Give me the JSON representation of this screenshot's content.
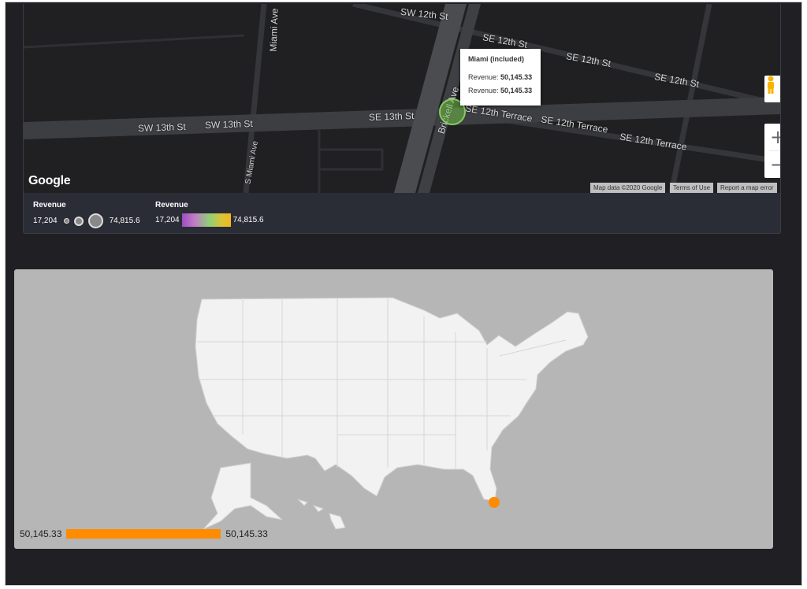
{
  "map": {
    "streets": {
      "sw12th": "SW 12th St",
      "se12th_a": "SE 12th St",
      "se12th_b": "SE 12th St",
      "se12th_c": "SE 12th St",
      "miami_ave": "Miami Ave",
      "sw13th_a": "SW 13th St",
      "sw13th_b": "SW 13th St",
      "se13th": "SE 13th St",
      "brickell": "Brickell Ave",
      "se12th_terrace_a": "SE 12th Terrace",
      "se12th_terrace_b": "SE 12th Terrace",
      "se12th_terrace_c": "SE 12th Terrace",
      "s_miami_ave": "S Miami Ave"
    },
    "google_logo": "Google",
    "attribution": {
      "map_data": "Map data ©2020 Google",
      "terms": "Terms of Use",
      "report": "Report a map error"
    },
    "tooltip": {
      "title": "Miami (included)",
      "row1_label": "Revenue:",
      "row1_value": "50,145.33",
      "row2_label": "Revenue:",
      "row2_value": "50,145.33"
    },
    "zoom_in": "+",
    "zoom_out": "−",
    "legend_size": {
      "title": "Revenue",
      "min": "17,204",
      "max": "74,815.6"
    },
    "legend_color": {
      "title": "Revenue",
      "min": "17,204",
      "max": "74,815.6"
    },
    "marker_color": "#7cc24e"
  },
  "us_map": {
    "legend_min": "50,145.33",
    "legend_max": "50,145.33",
    "point_color": "#ff8c00",
    "land_color": "#f2f2f2",
    "background_color": "#b6b6b6"
  }
}
